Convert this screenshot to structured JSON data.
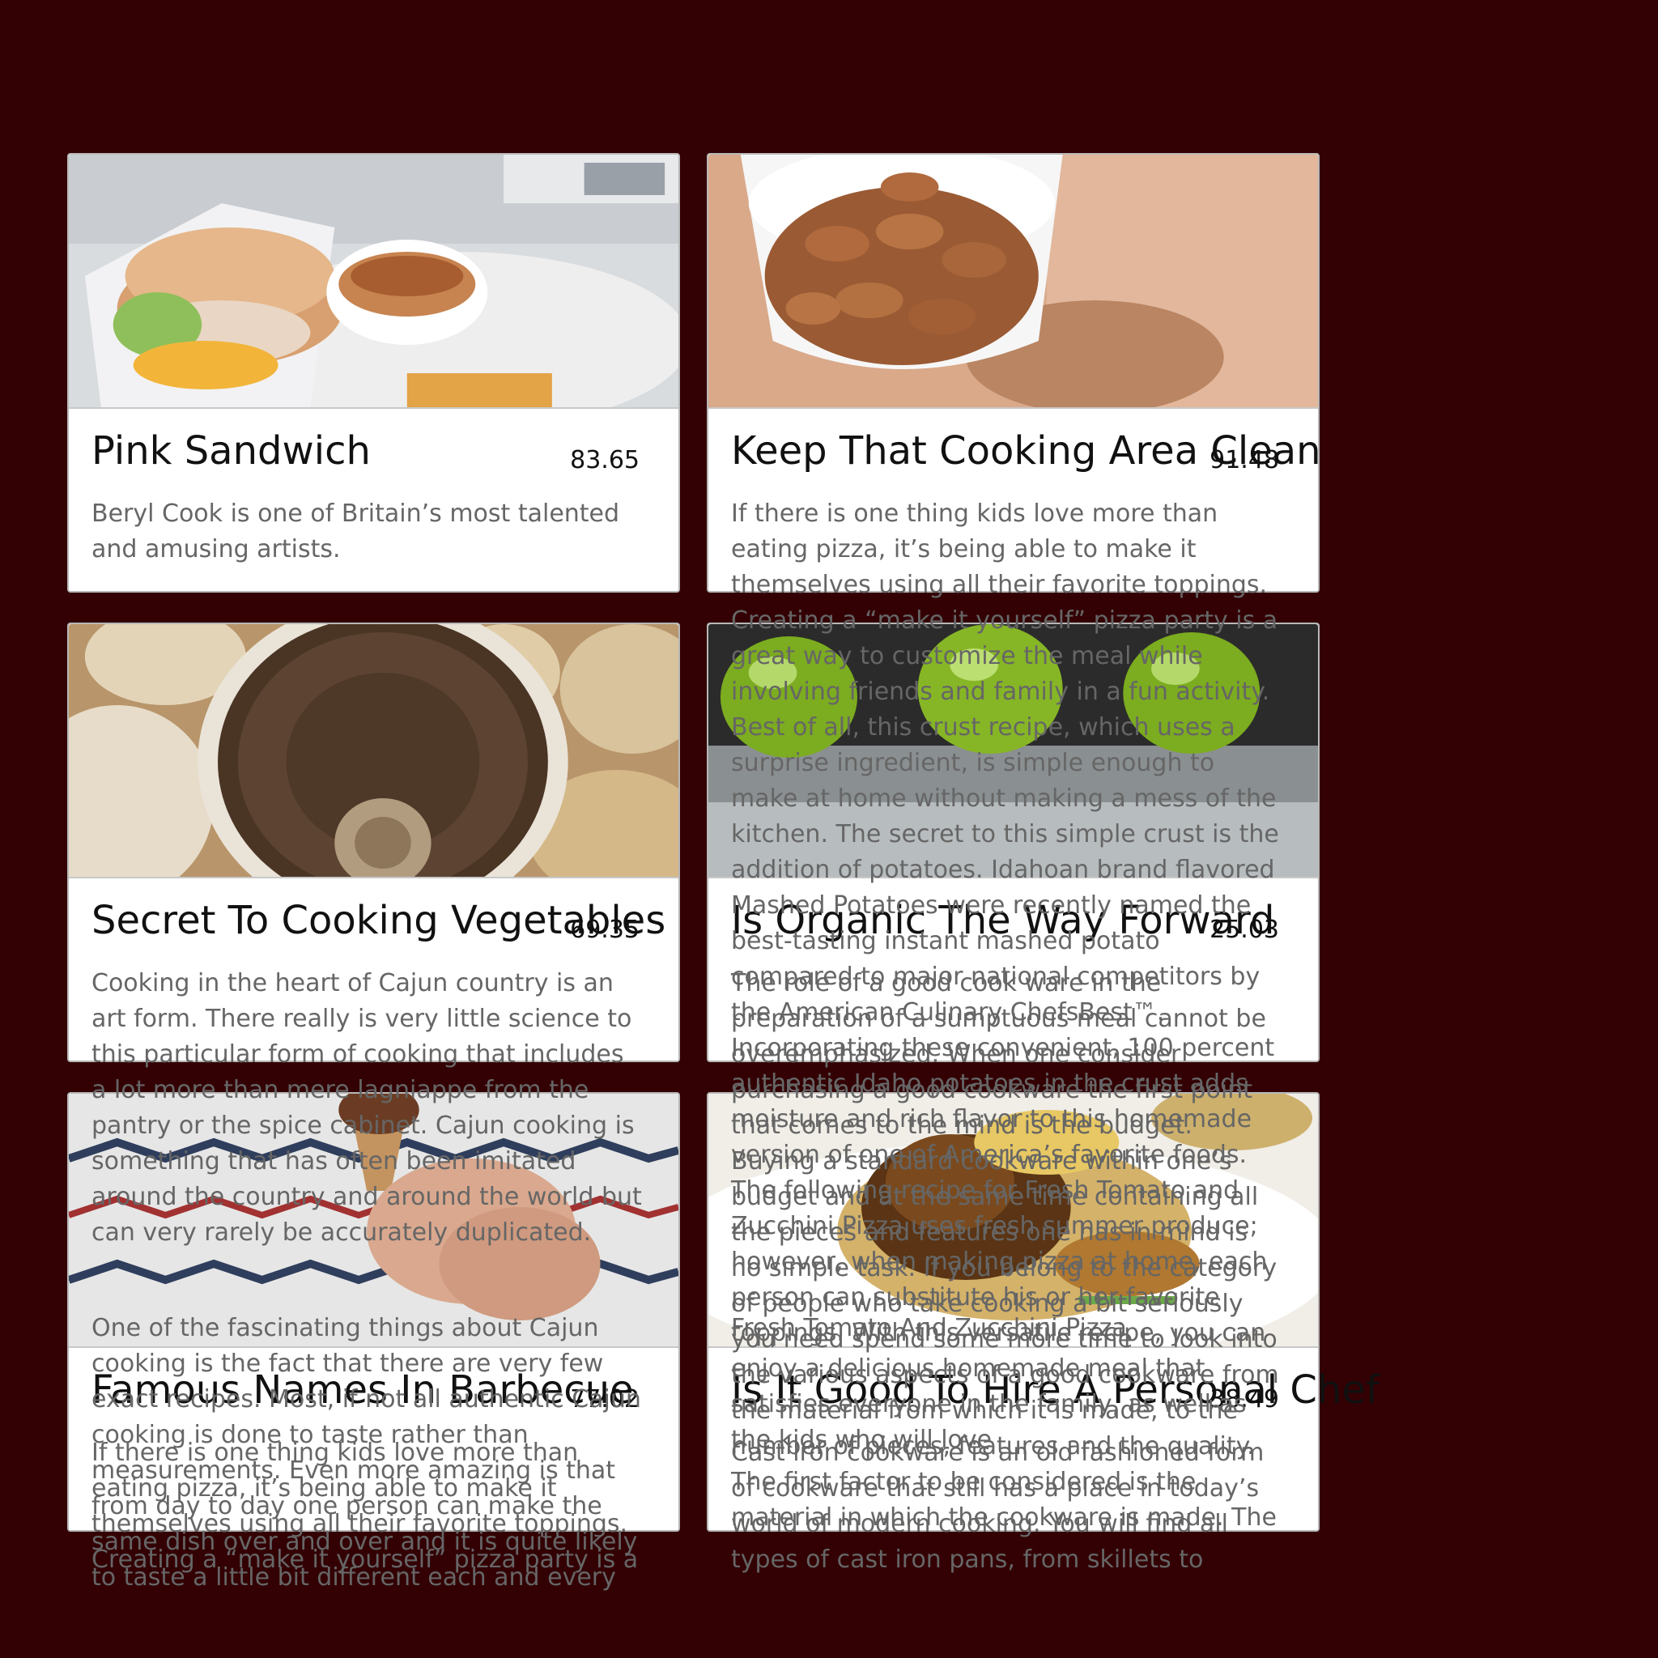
{
  "colors": {
    "background": "#330004",
    "card": "#ffffff",
    "title": "#111111",
    "description": "#666666"
  },
  "cards": [
    {
      "title": "Pink Sandwich",
      "price": "83.65",
      "image": "sandwich-with-soup-image",
      "description": "Beryl Cook is one of Britain’s most talented and amusing artists."
    },
    {
      "title": "Keep That Cooking Area Clean",
      "price": "91.48",
      "image": "almonds-bowl-image",
      "description": "If there is one thing kids love more than eating pizza, it’s being able to make it themselves using all their favorite toppings. Creating a “make it yourself” pizza party is a great way to customize the meal while involving friends and family in a fun activity. Best of all, this crust recipe, which uses a surprise ingredient, is simple enough to make at home without making a mess of the kitchen. The secret to this simple crust is the addition of potatoes. Idahoan brand flavored Mashed Potatoes were recently named the best-tasting instant mashed potato compared to major national competitors by the American Culinary ChefsBest™. Incorporating these convenient, 100 percent authentic Idaho potatoes in the crust adds moisture and rich flavor to this homemade version of one of America’s favorite foods. The following recipe for Fresh Tomato and Zucchini Pizza uses fresh summer produce; however, when making pizza at home, each person can substitute his or her favorite toppings. With this versatile recipe, you can enjoy a delicious homemade meal that satisfies everyone in the family, as well as the kids who will love",
      "description_extra": "Fresh Tomato And Zucchini Pizza"
    },
    {
      "title": "Secret To Cooking Vegetables",
      "price": "69.35",
      "image": "mushrooms-image",
      "description": "Cooking in the heart of Cajun country is an art form. There really is very little science to this particular form of cooking that includes a lot more than mere lagniappe from the pantry or the spice cabinet. Cajun cooking is something that has often been imitated around the country and around the world but can very rarely be accurately duplicated.",
      "description_2": "One of the fascinating things about Cajun cooking is the fact that there are very few exact recipes. Most, if not all authentic Cajun cooking is done to taste rather than measurements. Even more amazing is that from day to day one person can make the same dish over and over and it is quite likely to taste a little bit different each and every"
    },
    {
      "title": "Is Organic The Way Forward",
      "price": "25.03",
      "image": "green-apples-image",
      "description": "The role of a good cook ware in the preparation of a sumptuous meal cannot be overemphasized. When one consider purchasing a good cookware the first point that comes to the mind is the budget. Buying a standard cookware within one’s budget and at the same time containing all the pieces and features one has in mind is no simple task. If you belong to the category of people who take cooking a bit seriously you need spend some more time to look into the various aspects of a good cookware from the material from which it is made, to the number of pieces, features and the quality. The first factor to be considered is the material in which the cookware is made. The"
    },
    {
      "title": "Famous Names In Barbecue",
      "price": "77.02",
      "image": "ice-cream-cone-image",
      "description": "If there is one thing kids love more than eating pizza, it’s being able to make it themselves using all their favorite toppings. Creating a “make it yourself” pizza party is a"
    },
    {
      "title": "Is It Good To Hire A Personal Chef",
      "price": "38.49",
      "image": "plated-dish-image",
      "description": "Cast iron cookware is an old fashioned form of cookware that still has a place in today’s world of modern cooking. You will find all types of cast iron pans, from skillets to"
    }
  ]
}
